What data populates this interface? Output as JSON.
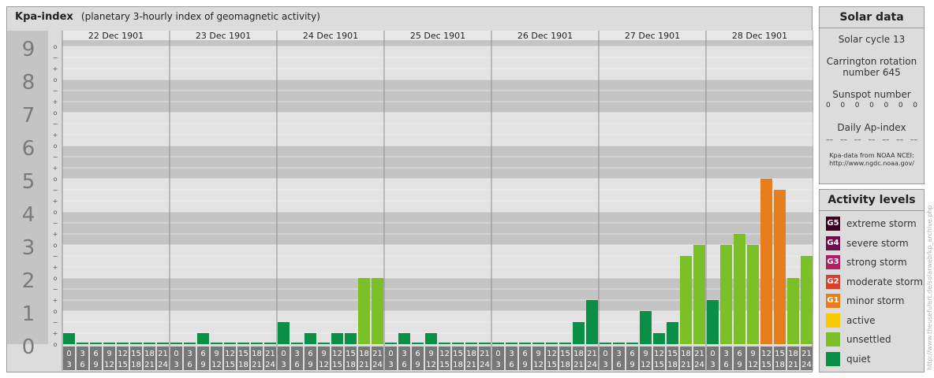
{
  "header": {
    "title": "Kpa-index",
    "subtitle": "(planetary 3-hourly index of geomagnetic activity)"
  },
  "chart_data": {
    "type": "bar",
    "title": "Kpa-index",
    "subtitle": "(planetary 3-hourly index of geomagnetic activity)",
    "ylim": [
      0,
      9.33
    ],
    "y_ticks": [
      "0",
      "1",
      "2",
      "3",
      "4",
      "5",
      "6",
      "7",
      "8",
      "9"
    ],
    "y_subticks": [
      "o",
      "+",
      "−"
    ],
    "days": [
      "22 Dec 1901",
      "23 Dec 1901",
      "24 Dec 1901",
      "25 Dec 1901",
      "26 Dec 1901",
      "27 Dec 1901",
      "28 Dec 1901"
    ],
    "interval_start": [
      "0",
      "3",
      "6",
      "9",
      "12",
      "15",
      "18",
      "21"
    ],
    "interval_end": [
      "3",
      "6",
      "9",
      "12",
      "15",
      "18",
      "21",
      "24"
    ],
    "values": [
      [
        0.333,
        0.0,
        0.0,
        0.0,
        0.0,
        0.0,
        0.0,
        0.0
      ],
      [
        0.0,
        0.0,
        0.333,
        0.0,
        0.0,
        0.0,
        0.0,
        0.0
      ],
      [
        0.667,
        0.0,
        0.333,
        0.0,
        0.333,
        0.333,
        2.0,
        2.0
      ],
      [
        0.0,
        0.333,
        0.0,
        0.333,
        0.0,
        0.0,
        0.0,
        0.0
      ],
      [
        0.0,
        0.0,
        0.0,
        0.0,
        0.0,
        0.0,
        0.667,
        1.333
      ],
      [
        0.0,
        0.0,
        0.0,
        1.0,
        0.333,
        0.667,
        2.667,
        3.0
      ],
      [
        1.333,
        3.0,
        3.333,
        3.0,
        5.0,
        4.667,
        2.0,
        2.667
      ]
    ]
  },
  "colors": {
    "quiet": "#0a8f46",
    "unsettled": "#7bc026",
    "active": "#f8c800",
    "g1": "#e67e1e",
    "g2": "#d9402c",
    "g3": "#b01e64",
    "g4": "#6e0e4c",
    "g5": "#3c0424",
    "band_dark": "#c4c4c4",
    "band_light": "#e3e3e3",
    "axis_label": "#7a7a7a"
  },
  "solar": {
    "title": "Solar data",
    "cycle": "Solar cycle 13",
    "carrington_line1": "Carrington rotation",
    "carrington_line2": "number 645",
    "sunspot_label": "Sunspot number",
    "sunspot_values": [
      "0",
      "0",
      "0",
      "0",
      "0",
      "0",
      "0"
    ],
    "ap_label": "Daily Ap-index",
    "ap_values": [
      "––",
      "––",
      "––",
      "––",
      "––",
      "––",
      "––"
    ],
    "source_line1": "Kpa-data from NOAA NCEI:",
    "source_line2": "http://www.ngdc.noaa.gov/"
  },
  "activity": {
    "title": "Activity levels",
    "items": [
      {
        "code": "G5",
        "label": "extreme storm",
        "color": "#3c0424"
      },
      {
        "code": "G4",
        "label": "severe storm",
        "color": "#6e0e4c"
      },
      {
        "code": "G3",
        "label": "strong storm",
        "color": "#b01e64"
      },
      {
        "code": "G2",
        "label": "moderate storm",
        "color": "#d9402c"
      },
      {
        "code": "G1",
        "label": "minor storm",
        "color": "#e67e1e"
      },
      {
        "code": "",
        "label": "active",
        "color": "#f8c800"
      },
      {
        "code": "",
        "label": "unsettled",
        "color": "#7bc026"
      },
      {
        "code": "",
        "label": "quiet",
        "color": "#0a8f46"
      }
    ]
  },
  "watermark": "http://www.theusefulart.de/solarweb/kp_archive.php"
}
